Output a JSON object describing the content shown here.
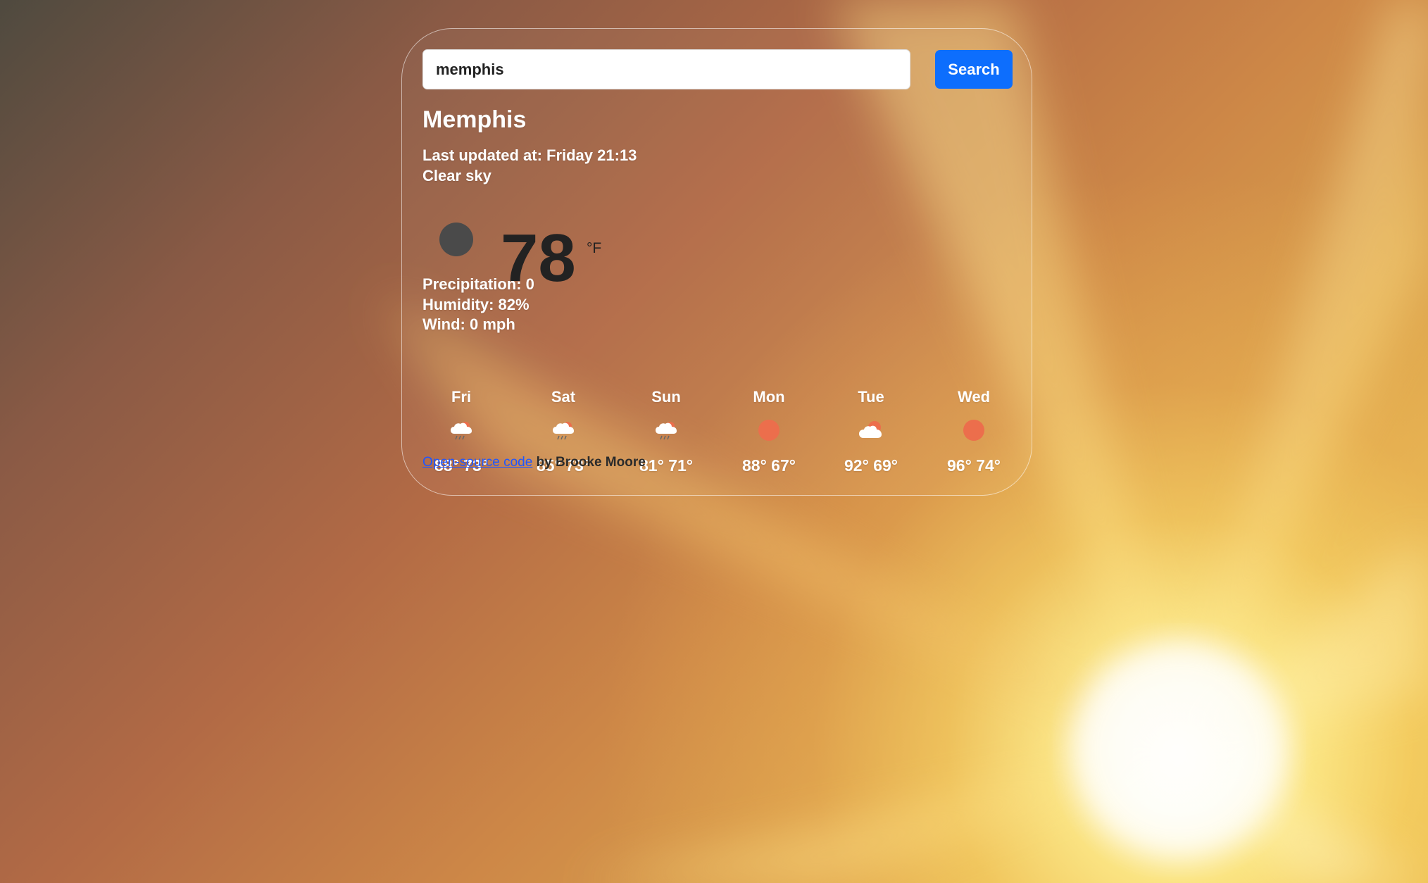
{
  "search": {
    "value": "memphis",
    "button_label": "Search"
  },
  "weather": {
    "city": "Memphis",
    "last_updated": "Last updated at: Friday 21:13",
    "description": "Clear sky",
    "temperature": "78",
    "unit": "°F",
    "precipitation": "Precipitation: 0",
    "humidity": "Humidity: 82%",
    "wind": "Wind: 0 mph",
    "current_icon": "dark-moon-icon"
  },
  "forecast": [
    {
      "day": "Fri",
      "icon": "rain-cloud-icon",
      "temps": "88° 73°"
    },
    {
      "day": "Sat",
      "icon": "rain-cloud-icon",
      "temps": "85° 73°"
    },
    {
      "day": "Sun",
      "icon": "rain-cloud-icon",
      "temps": "81° 71°"
    },
    {
      "day": "Mon",
      "icon": "sun-icon",
      "temps": "88° 67°"
    },
    {
      "day": "Tue",
      "icon": "partly-cloudy-icon",
      "temps": "92° 69°"
    },
    {
      "day": "Wed",
      "icon": "sun-icon",
      "temps": "96° 74°"
    }
  ],
  "footer": {
    "link_text": "Open-source code",
    "suffix": " by Brooke Moore"
  },
  "colors": {
    "accent_button": "#0d6efd",
    "sun": "#ec6e4c",
    "moon": "#4a4a4a"
  }
}
